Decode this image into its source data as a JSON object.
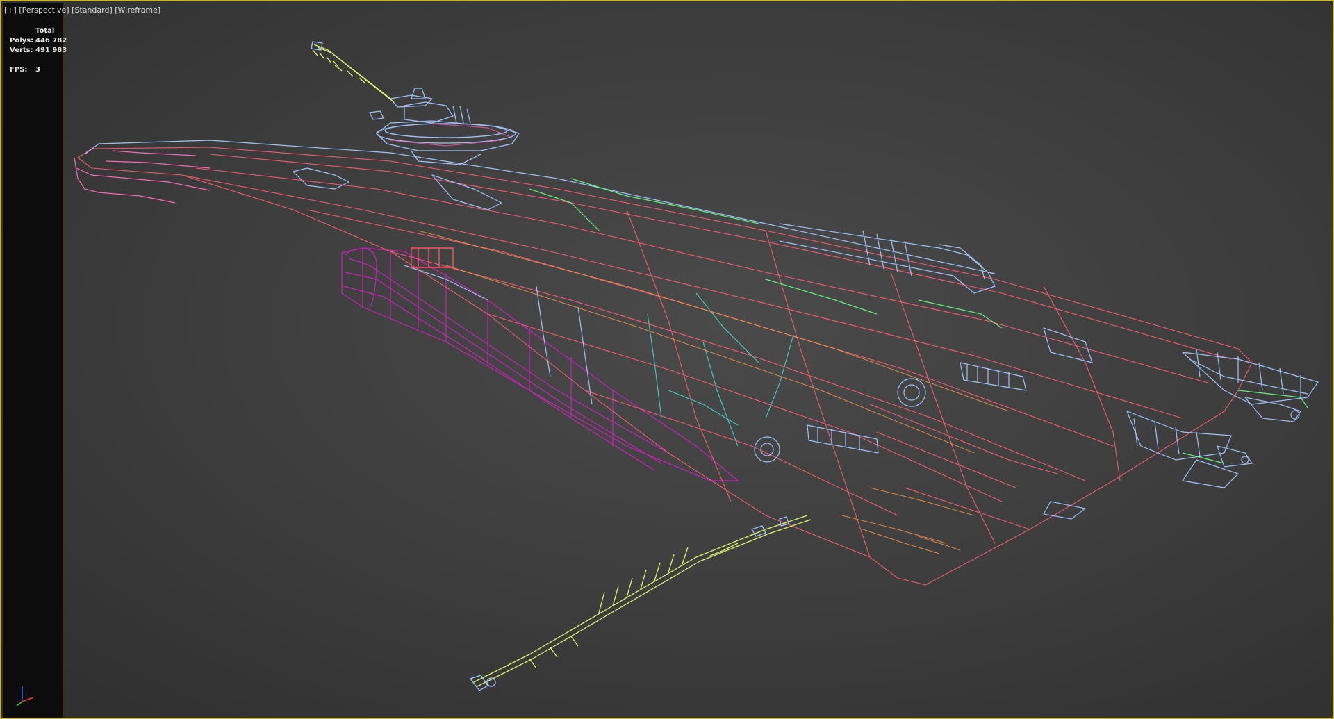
{
  "viewport": {
    "labels": {
      "menu": "[+]",
      "view": "[Perspective]",
      "shading_preset": "[Standard]",
      "shading_mode": "[Wireframe]"
    },
    "stats": {
      "header": "Total",
      "polys_label": "Polys:",
      "polys_value": "446 782",
      "verts_label": "Verts:",
      "verts_value": "491 983",
      "fps_label": "FPS:",
      "fps_value": "3"
    },
    "colors": {
      "border": "#c8b33c",
      "background": "#3e3e3e",
      "wire_pink": "#e85aa8",
      "wire_magenta": "#d020c0",
      "wire_red": "#ff4f5f",
      "wire_lightblue": "#a9c8ff",
      "wire_green": "#6aff8a",
      "wire_yellow": "#e8ff70",
      "wire_orange": "#ff9a50",
      "wire_cyan": "#40e8d0"
    }
  }
}
